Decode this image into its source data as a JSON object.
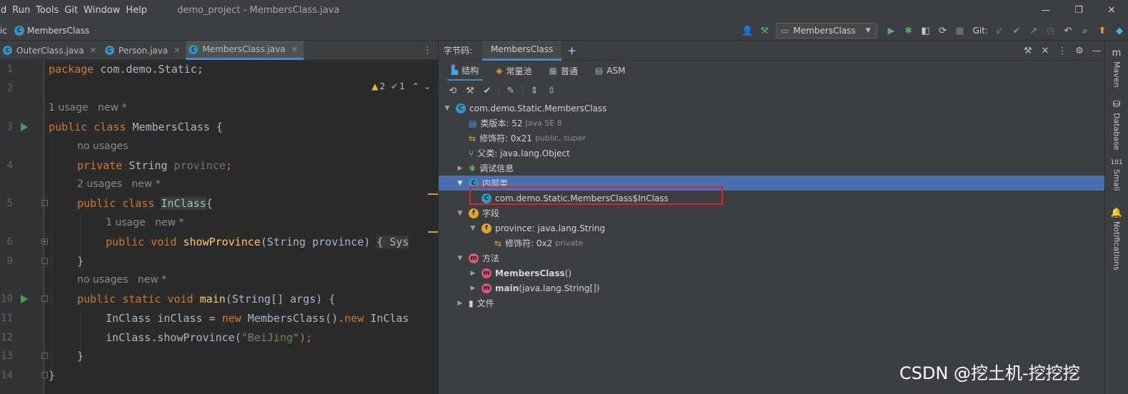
{
  "menubar": {
    "items": [
      "d",
      "Run",
      "Tools",
      "Git",
      "Window",
      "Help"
    ],
    "window_title": "demo_project - MembersClass.java"
  },
  "navbar": {
    "crumb_prefix": "ic",
    "crumb_class": "MembersClass",
    "run_config": "MembersClass",
    "git_label": "Git:"
  },
  "editor": {
    "tabs": [
      {
        "label": "OuterClass.java",
        "active": false
      },
      {
        "label": "Person.java",
        "active": false
      },
      {
        "label": "MembersClass.java",
        "active": true
      }
    ],
    "warnings_count": "2",
    "ok_count": "1",
    "line_numbers": [
      "1",
      "2",
      "3",
      "4",
      "5",
      "6",
      "9",
      "10",
      "11",
      "12",
      "13",
      "14"
    ],
    "hints": {
      "h1": "1 usage   new *",
      "h2": "no usages",
      "h3": "2 usages   new *",
      "h4": "1 usage   new *",
      "h5": "no usages   new *"
    },
    "code": {
      "package_kw": "package",
      "package_name": " com.demo.Static;",
      "public_kw": "public",
      "class_kw": " class",
      "class_name": " MembersClass {",
      "private_kw": "private",
      "string_type": " String ",
      "province_field": "province",
      "semicolon": ";",
      "inner_public": "public",
      "inner_class_kw": " class ",
      "inner_class_name": "InClass",
      "inner_brace": "{",
      "method_public": "public",
      "method_void": " void ",
      "method_name": "showProvince",
      "method_params": "(String province) ",
      "method_body": "{ Sys",
      "close_brace_inner": "}",
      "main_public": "public",
      "main_static": " static",
      "main_void": " void ",
      "main_name": "main",
      "main_params": "(String[] args) {",
      "assign_type": "InClass inClass = ",
      "assign_new1": "new",
      "assign_ctor": " MembersClass().",
      "assign_new2": "new",
      "assign_tail": " InClas",
      "call_prefix": "inClass.showProvince(",
      "call_str": "\"BeiJing\"",
      "call_suffix": ");",
      "close_brace_main": "}",
      "close_brace_class": "}"
    }
  },
  "panel": {
    "title": "字节码:",
    "tab": "MembersClass",
    "subtabs": [
      "结构",
      "常量池",
      "普通",
      "ASM"
    ],
    "tree": {
      "root": "com.demo.Static.MembersClass",
      "version_label": "类版本: 52",
      "version_dim": "Java SE 8",
      "modifiers_label": "修饰符: 0x21",
      "modifiers_dim": "public, super",
      "super_label": "父类: java.lang.Object",
      "debug_label": "调试信息",
      "inner_label": "内部类",
      "inner_item": "com.demo.Static.MembersClass$InClass",
      "fields_label": "字段",
      "field_item": "province: java.lang.String",
      "field_mod_label": "修饰符: 0x2",
      "field_mod_dim": "private",
      "methods_label": "方法",
      "method1_name": "MembersClass",
      "method1_sig": "()",
      "method2_name": "main",
      "method2_sig": "(java.lang.String[])",
      "file_label": "文件"
    }
  },
  "sidestrip": [
    "Maven",
    "Database",
    "Smali",
    "Notifications"
  ],
  "watermark": "CSDN @挖土机-挖挖挖",
  "colors": {
    "accent": "#4a88c7",
    "selection": "#4b6eaf",
    "highlight_box": "#e0212b"
  }
}
